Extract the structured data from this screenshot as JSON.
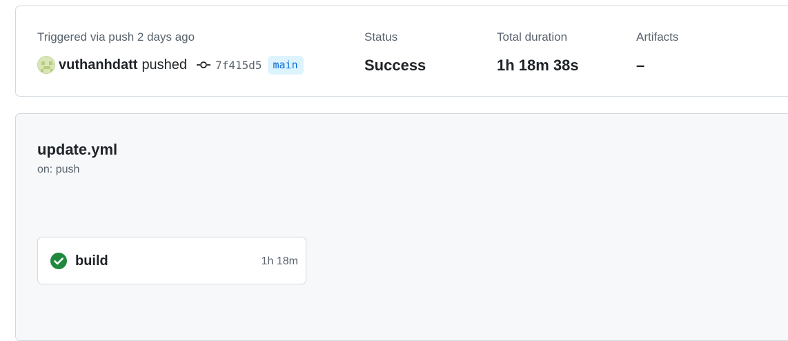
{
  "summary": {
    "trigger_label": "Triggered via push 2 days ago",
    "actor": "vuthanhdatt",
    "action": "pushed",
    "commit_sha": "7f415d5",
    "branch": "main",
    "status_label": "Status",
    "status_value": "Success",
    "duration_label": "Total duration",
    "duration_value": "1h 18m 38s",
    "artifacts_label": "Artifacts",
    "artifacts_value": "–"
  },
  "workflow": {
    "file_name": "update.yml",
    "trigger": "on: push",
    "jobs": [
      {
        "name": "build",
        "duration": "1h 18m",
        "status_icon": "check-circle-fill-icon",
        "status_color": "#1f883d"
      }
    ]
  },
  "colors": {
    "branch_badge_bg": "#ddf4ff",
    "branch_badge_text": "#0969da",
    "success": "#1f883d",
    "muted_text": "#59636e",
    "border": "#d1d9e0",
    "workflow_bg": "#f6f8fa"
  }
}
